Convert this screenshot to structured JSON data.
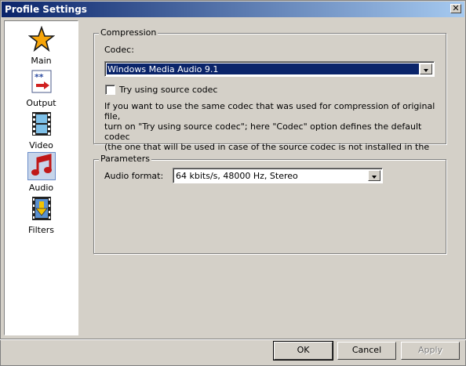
{
  "window": {
    "title": "Profile Settings",
    "close_glyph": "✕"
  },
  "sidebar": {
    "items": [
      {
        "label": "Main",
        "icon": "star-icon"
      },
      {
        "label": "Output",
        "icon": "output-icon"
      },
      {
        "label": "Video",
        "icon": "film-icon"
      },
      {
        "label": "Audio",
        "icon": "music-note-icon"
      },
      {
        "label": "Filters",
        "icon": "filter-icon"
      }
    ],
    "active": "Audio"
  },
  "compression": {
    "legend": "Compression",
    "codec_label": "Codec:",
    "codec_value": "Windows Media Audio 9.1",
    "try_source_label": "Try using source codec",
    "try_source_checked": false,
    "info_lines": [
      "If you want to use the same codec that was used for compression of original file,",
      "turn on \"Try using source codec\"; here \"Codec\" option defines the default codec",
      "(the one that will be used in case of the source codec is not installed in the system)"
    ]
  },
  "parameters": {
    "legend": "Parameters",
    "audio_format_label": "Audio format:",
    "audio_format_value": "64 kbits/s, 48000 Hz, Stereo"
  },
  "buttons": {
    "ok": "OK",
    "cancel": "Cancel",
    "apply": "Apply"
  }
}
